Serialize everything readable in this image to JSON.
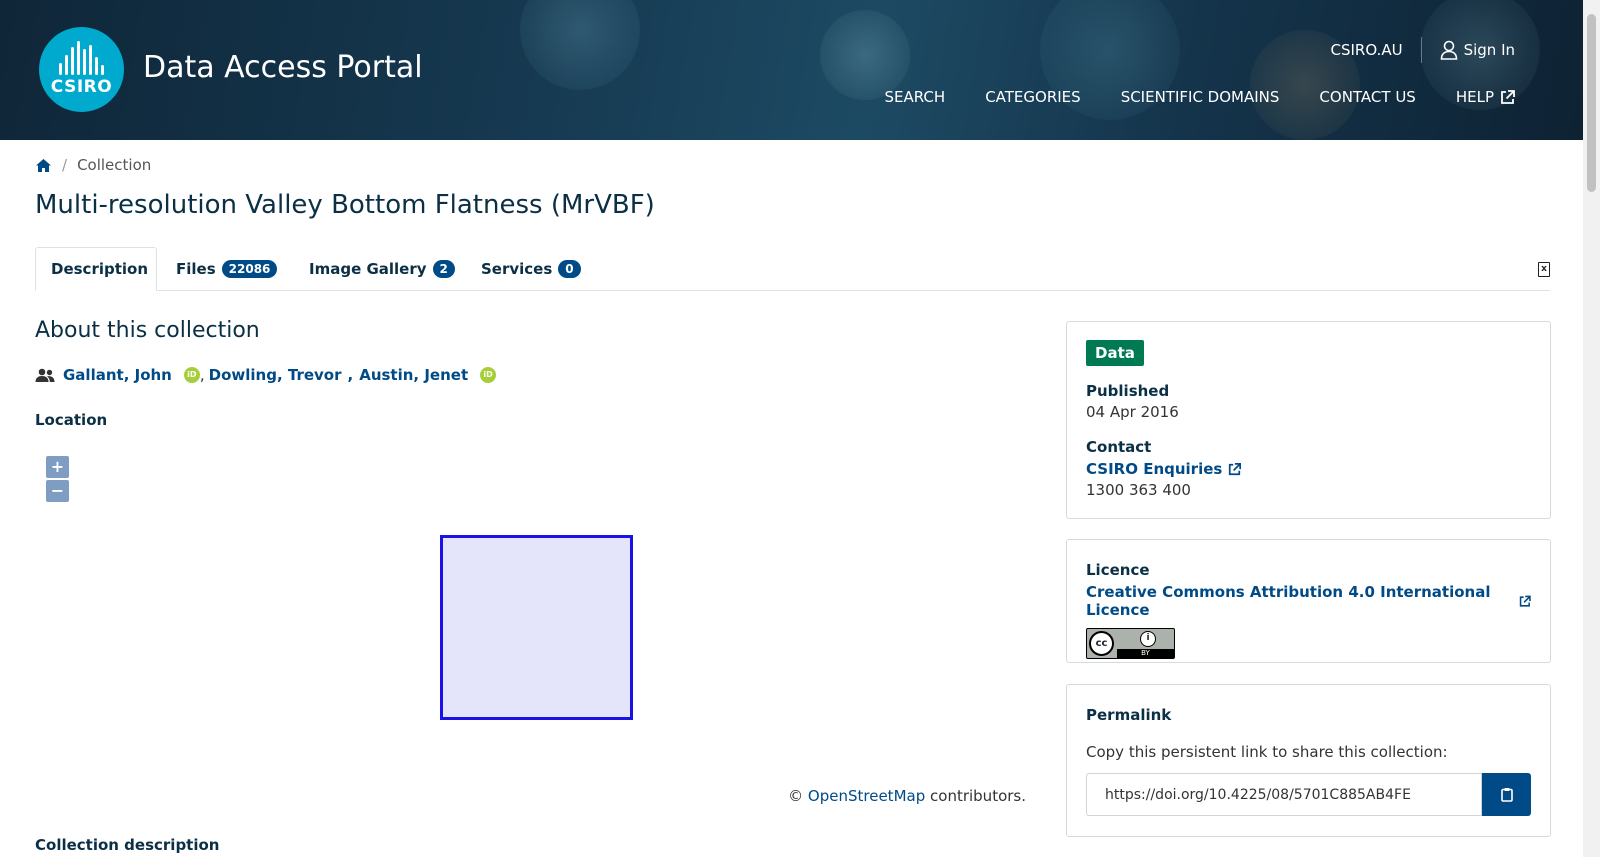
{
  "header": {
    "logo_text": "CSIRO",
    "site_title": "Data Access Portal",
    "csiro_link": "CSIRO.AU",
    "sign_in": "Sign In",
    "nav": [
      "SEARCH",
      "CATEGORIES",
      "SCIENTIFIC DOMAINS",
      "CONTACT US",
      "HELP"
    ]
  },
  "breadcrumb": {
    "current": "Collection"
  },
  "page_title": "Multi-resolution Valley Bottom Flatness (MrVBF)",
  "tabs": [
    {
      "label": "Description",
      "active": true
    },
    {
      "label": "Files",
      "count": "22086"
    },
    {
      "label": "Image Gallery",
      "count": "2"
    },
    {
      "label": "Services",
      "count": "0"
    }
  ],
  "about": {
    "heading": "About this collection",
    "authors": [
      "Gallant, John",
      "Dowling, Trevor",
      "Austin, Jenet"
    ],
    "location_label": "Location"
  },
  "map": {
    "zoom_in": "+",
    "zoom_out": "−",
    "attribution_prefix": "©",
    "attribution_link": "OpenStreetMap",
    "attribution_suffix": "contributors."
  },
  "collection_description_label": "Collection description",
  "info_card": {
    "type_badge": "Data",
    "published_label": "Published",
    "published_value": "04 Apr 2016",
    "contact_label": "Contact",
    "contact_link": "CSIRO Enquiries",
    "contact_phone": "1300 363 400"
  },
  "licence_card": {
    "label": "Licence",
    "link": "Creative Commons Attribution 4.0 International Licence",
    "badge_text": "BY"
  },
  "permalink_card": {
    "label": "Permalink",
    "description": "Copy this persistent link to share this collection:",
    "url": "https://doi.org/10.4225/08/5701C885AB4FE"
  },
  "colors": {
    "brand_blue": "#004b87",
    "csiro_teal": "#00a9ce",
    "data_green": "#007a53",
    "bbox_stroke": "#1a10e8"
  }
}
